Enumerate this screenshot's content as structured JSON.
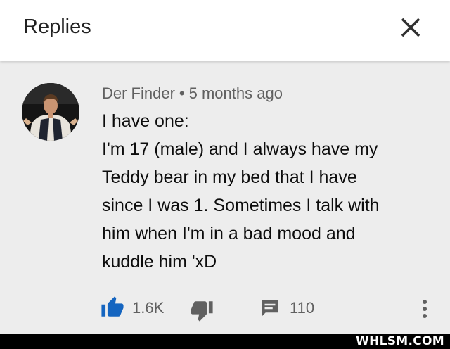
{
  "header": {
    "title": "Replies",
    "close_icon": "close-icon"
  },
  "comment": {
    "avatar": "avatar",
    "author": "Der Finder",
    "separator": "•",
    "timestamp": "5 months ago",
    "lines": [
      "I have one:",
      "I'm 17 (male) and I always have my",
      "Teddy bear in my bed that I have",
      "since I was 1. Sometimes I talk with",
      "him when I'm in a bad mood and",
      "kuddle him 'xD"
    ],
    "like_count": "1.6K",
    "reply_count": "110",
    "icons": [
      "thumbs-up-icon",
      "thumbs-down-icon",
      "comment-icon",
      "more-vert-icon"
    ]
  },
  "colors": {
    "accent": "#1565c0",
    "meta_text": "#606060",
    "background": "#ededed"
  },
  "watermark": "WHLSM.COM"
}
